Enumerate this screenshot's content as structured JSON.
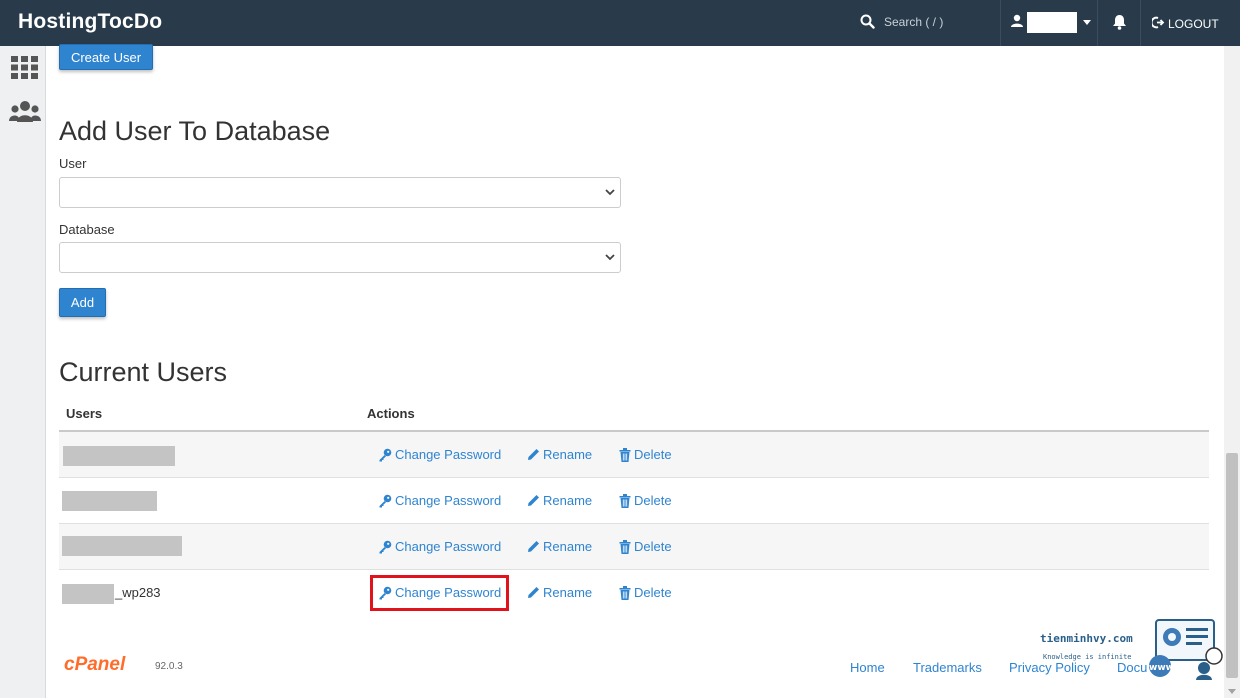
{
  "header": {
    "brand": "HostingTocDo",
    "search_placeholder": "Search ( / )",
    "logout_label": "LOGOUT"
  },
  "sidebar": {
    "icons": [
      "grid-icon",
      "users-icon"
    ]
  },
  "create_user_label": "Create User",
  "add_user_section": {
    "title": "Add User To Database",
    "user_label": "User",
    "user_value": "",
    "database_label": "Database",
    "database_value": "",
    "add_label": "Add"
  },
  "current_users": {
    "title": "Current Users",
    "columns": [
      "Users",
      "Actions"
    ],
    "rows": [
      {
        "user": ""
      },
      {
        "user": ""
      },
      {
        "user": ""
      },
      {
        "user": "_wp283"
      }
    ],
    "actions": {
      "change_password": "Change Password",
      "rename": "Rename",
      "delete": "Delete"
    }
  },
  "footer": {
    "brand": "cPanel",
    "version": "92.0.3",
    "links": [
      "Home",
      "Trademarks",
      "Privacy Policy",
      "Docu"
    ]
  },
  "watermark": {
    "site": "tienminhvy.com",
    "tagline": "Knowledge is infinite",
    "logo_text": "www"
  },
  "colors": {
    "topbar": "#293a4a",
    "primary": "#2f84d0",
    "highlight": "#e0121b",
    "cpanel_orange": "#ff6c2c"
  }
}
